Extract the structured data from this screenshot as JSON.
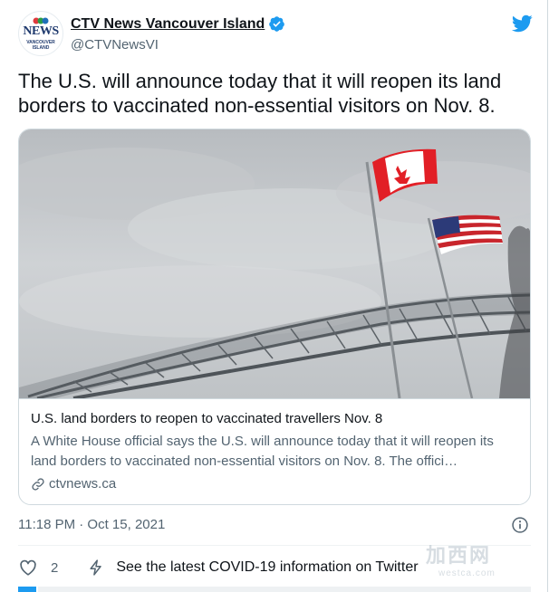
{
  "account": {
    "avatar_word": "NEWS",
    "avatar_sub": "VANCOUVER ISLAND",
    "display_name": "CTV News Vancouver Island",
    "handle": "@CTVNewsVI",
    "verified": true
  },
  "tweet": {
    "text": "The U.S. will announce today that it will reopen its land borders to vaccinated non-essential visitors on Nov. 8.",
    "timestamp": "11:18 PM · Oct 15, 2021"
  },
  "link_card": {
    "title": "U.S. land borders to reopen to vaccinated travellers Nov. 8",
    "description": "A White House official says the U.S. will announce today that it will reopen its land borders to vaccinated non-essential visitors on Nov. 8. The offici…",
    "domain": "ctvnews.ca"
  },
  "actions": {
    "like_count": "2",
    "covid_info": "See the latest COVID-19 information on Twitter"
  },
  "watermark": {
    "cn": "加西网",
    "en": "westca.com"
  },
  "colors": {
    "twitter_blue": "#1d9bf0",
    "text_primary": "#0f1419",
    "text_secondary": "#536471",
    "border": "#cfd9de"
  },
  "icons": [
    "twitter-bird-icon",
    "verified-badge-icon",
    "link-icon",
    "info-icon",
    "heart-icon",
    "lightning-icon"
  ]
}
